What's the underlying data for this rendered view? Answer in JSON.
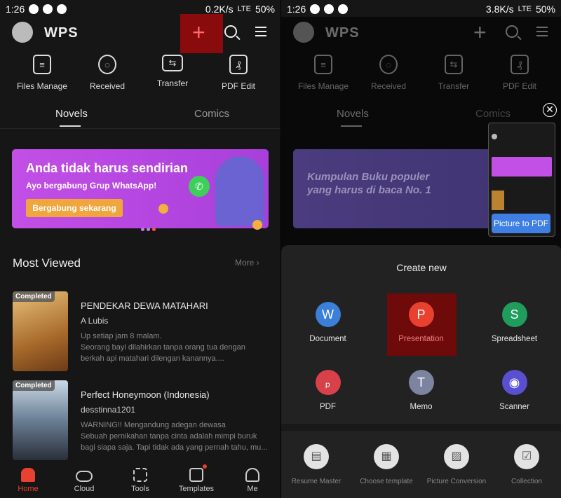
{
  "left": {
    "status": {
      "time": "1:26",
      "speed": "0.2K/s",
      "network": "LTE",
      "battery": "50%"
    },
    "header": {
      "logo": "WPS"
    },
    "quick_actions": [
      {
        "label": "Files Manage",
        "icon": "file-list-icon"
      },
      {
        "label": "Received",
        "icon": "satellite-dish-icon"
      },
      {
        "label": "Transfer",
        "icon": "folder-transfer-icon"
      },
      {
        "label": "PDF Edit",
        "icon": "pdf-edit-icon"
      }
    ],
    "tabs": [
      "Novels",
      "Comics"
    ],
    "banner": {
      "title": "Anda tidak harus sendirian",
      "subtitle": "Ayo bergabung Grup WhatsApp!",
      "button": "Bergabung sekarang"
    },
    "section": {
      "title": "Most Viewed",
      "more": "More"
    },
    "books": [
      {
        "badge": "Completed",
        "title": "PENDEKAR DEWA MATAHARI",
        "author": "A Lubis",
        "desc": [
          "Up setiap jam 8 malam.",
          "Seorang bayi dilahirkan tanpa orang tua dengan",
          "berkah api matahari dilengan kanannya...."
        ]
      },
      {
        "badge": "Completed",
        "title": "Perfect Honeymoon (Indonesia)",
        "author": "desstinna1201",
        "desc": [
          "WARNING!! Mengandung adegan dewasa",
          "Sebuah pernikahan tanpa cinta adalah mimpi buruk",
          "bagi siapa saja. Tapi tidak ada yang pernah tahu, mu..."
        ]
      }
    ],
    "nav": [
      {
        "label": "Home",
        "icon": "home-icon",
        "active": true
      },
      {
        "label": "Cloud",
        "icon": "cloud-icon"
      },
      {
        "label": "Tools",
        "icon": "grid-icon"
      },
      {
        "label": "Templates",
        "icon": "templates-icon"
      },
      {
        "label": "Me",
        "icon": "user-icon"
      }
    ]
  },
  "right": {
    "status": {
      "time": "1:26",
      "speed": "3.8K/s",
      "network": "LTE",
      "battery": "50%"
    },
    "banner": {
      "title": "Kumpulan Buku populer yang harus di baca No. 1"
    },
    "picture_to_pdf": "Picture to PDF",
    "sheet": {
      "title": "Create new",
      "items": [
        {
          "label": "Document",
          "glyph": "W",
          "color": "#3b7fd9"
        },
        {
          "label": "Presentation",
          "glyph": "P",
          "color": "#e8412f"
        },
        {
          "label": "Spreadsheet",
          "glyph": "S",
          "color": "#1f9d5c"
        },
        {
          "label": "PDF",
          "glyph": "ₚ",
          "color": "#d9414a"
        },
        {
          "label": "Memo",
          "glyph": "T",
          "color": "#7c84a0"
        },
        {
          "label": "Scanner",
          "glyph": "◉",
          "color": "#5a4ed1"
        }
      ],
      "tools": [
        {
          "label": "Resume Master",
          "glyph": "▤"
        },
        {
          "label": "Choose template",
          "glyph": "▦"
        },
        {
          "label": "Picture Conversion",
          "glyph": "▨"
        },
        {
          "label": "Collection",
          "glyph": "☑"
        }
      ]
    }
  },
  "colors": {
    "accent": "#e8412f",
    "highlight": "#8a0b0b",
    "banner": "#c24fe6"
  }
}
